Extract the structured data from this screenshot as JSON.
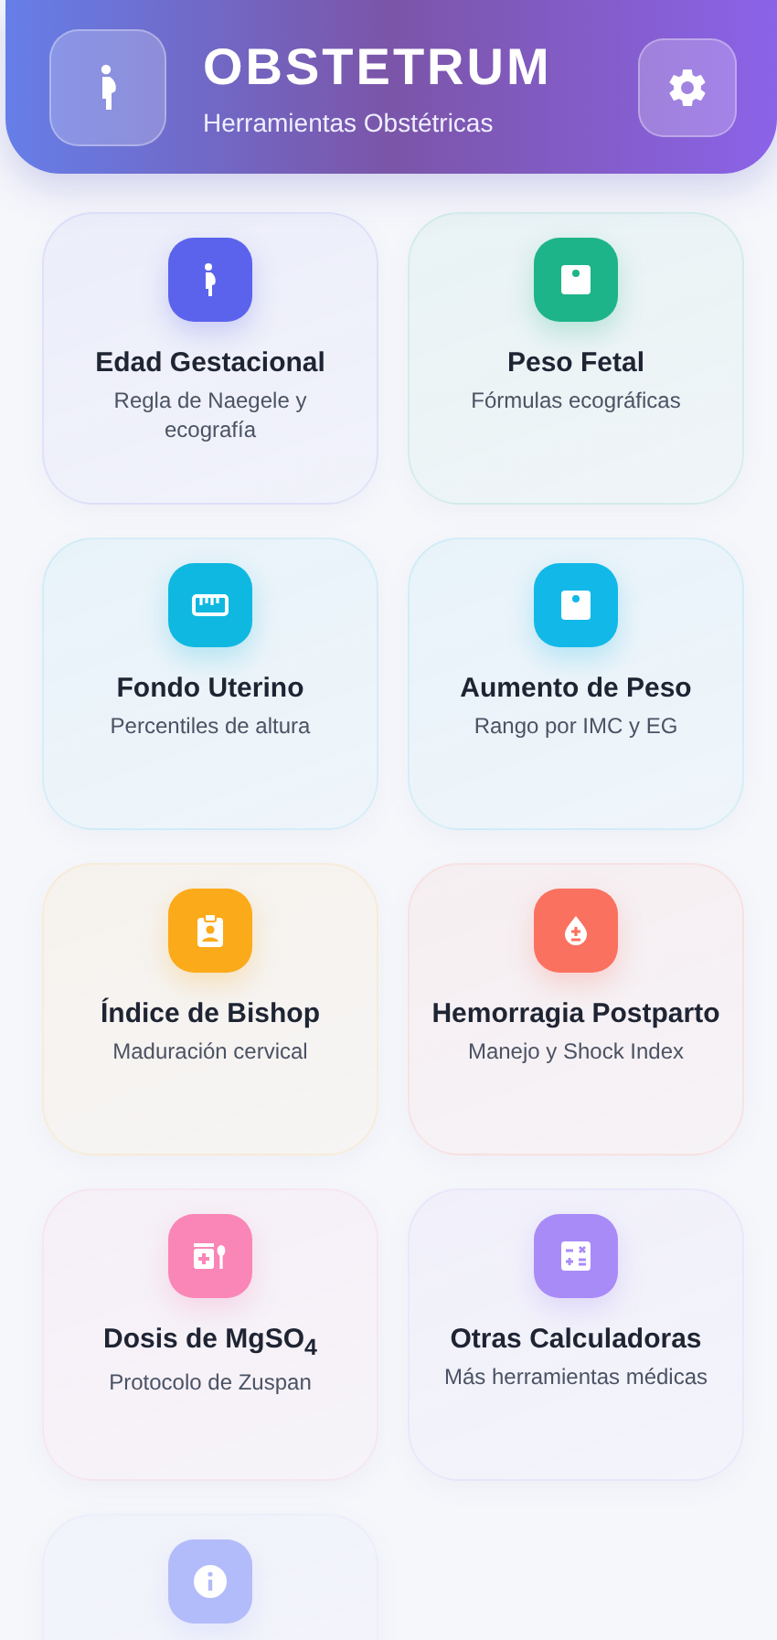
{
  "header": {
    "title": "OBSTETRUM",
    "subtitle": "Herramientas Obstétricas"
  },
  "cards": [
    {
      "kind": "pregnant",
      "color": "#5b63ec",
      "title": "Edad Gestacional",
      "subtitle": "Regla de Naegele y ecografía"
    },
    {
      "kind": "scale",
      "color": "#1eb489",
      "title": "Peso Fetal",
      "subtitle": "Fórmulas ecográficas"
    },
    {
      "kind": "ruler",
      "color": "#0fb8e0",
      "title": "Fondo Uterino",
      "subtitle": "Percentiles de altura"
    },
    {
      "kind": "scale",
      "color": "#12b9e8",
      "title": "Aumento de Peso",
      "subtitle": "Rango por IMC y EG"
    },
    {
      "kind": "clipboard",
      "color": "#fbaa1a",
      "title": "Índice de Bishop",
      "subtitle": "Maduración cervical"
    },
    {
      "kind": "drop",
      "color": "#fb715f",
      "title": "Hemorragia Postparto",
      "subtitle": "Manejo y Shock Index"
    },
    {
      "kind": "medicine",
      "color": "#f986b6",
      "title": "Dosis de MgSO$_{4}$",
      "subtitle": "Protocolo de Zuspan"
    },
    {
      "kind": "calculator",
      "color": "#a98bf8",
      "title": "Otras Calculadoras",
      "subtitle": "Más herramientas médicas"
    },
    {
      "kind": "info",
      "color": "#b3bcfa"
    }
  ]
}
